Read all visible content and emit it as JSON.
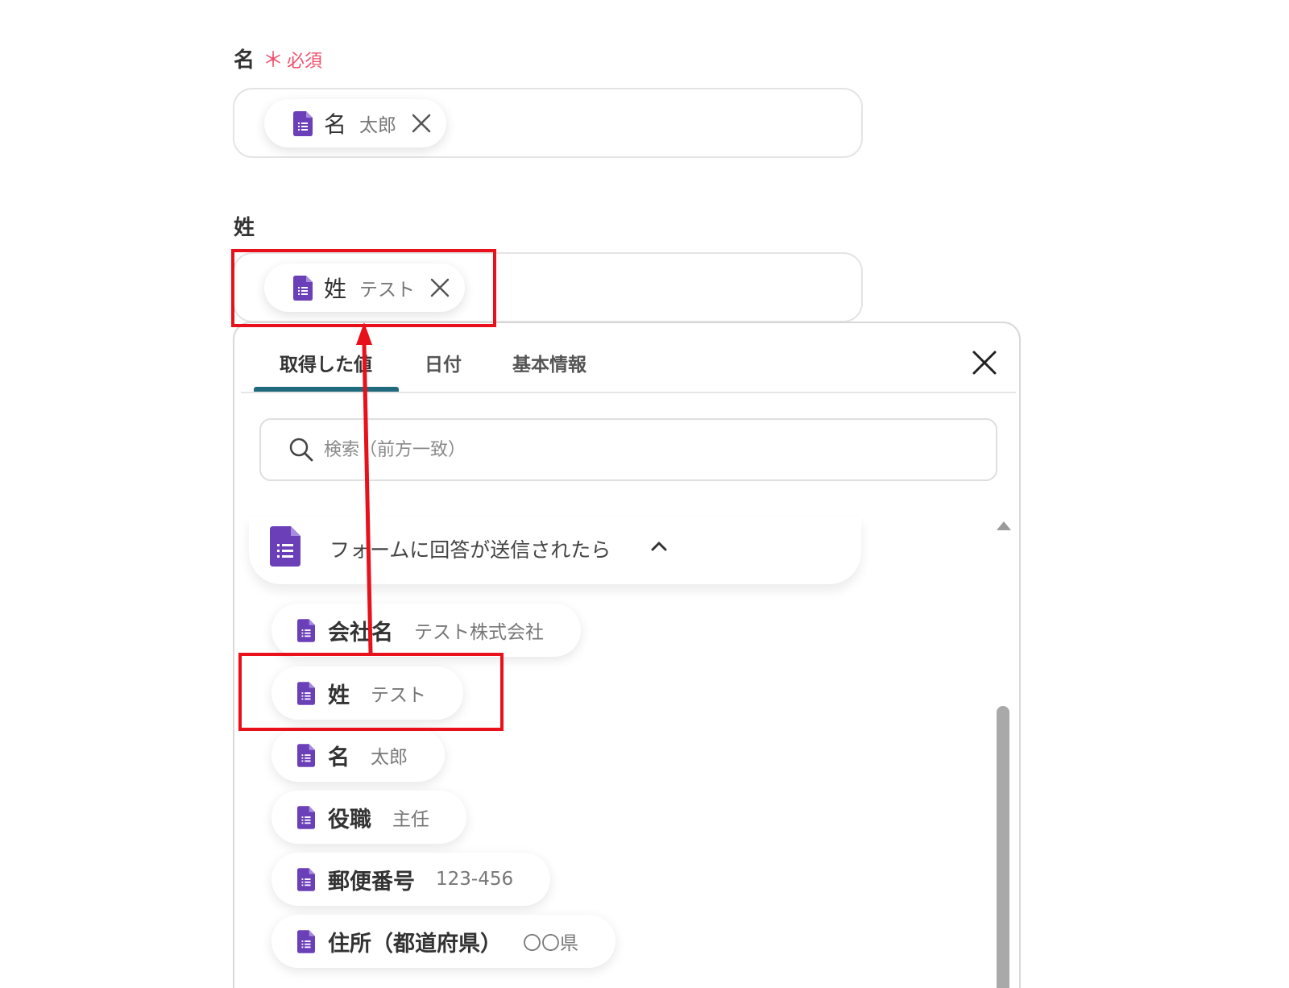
{
  "fields": {
    "first_name": {
      "label": "名",
      "required_mark": "＊",
      "required_text": "必須",
      "chip": {
        "name": "名",
        "value": "太郎"
      }
    },
    "last_name": {
      "label": "姓",
      "chip": {
        "name": "姓",
        "value": "テスト"
      }
    }
  },
  "picker": {
    "tabs": [
      {
        "label": "取得した値",
        "active": true
      },
      {
        "label": "日付",
        "active": false
      },
      {
        "label": "基本情報",
        "active": false
      }
    ],
    "search_placeholder": "検索（前方一致）",
    "section": {
      "title": "フォームに回答が送信されたら",
      "expanded": true
    },
    "items": [
      {
        "name": "会社名",
        "value": "テスト株式会社"
      },
      {
        "name": "姓",
        "value": "テスト"
      },
      {
        "name": "名",
        "value": "太郎"
      },
      {
        "name": "役職",
        "value": "主任"
      },
      {
        "name": "郵便番号",
        "value": "123-456"
      },
      {
        "name": "住所（都道府県）",
        "value": "〇〇県"
      }
    ]
  },
  "colors": {
    "accent_tab": "#1f6a7c",
    "highlight": "#e8101a",
    "required": "#f0506e",
    "forms_icon": "#6b3fb8"
  },
  "icons": {
    "form_icon": "google-forms-icon",
    "close_icon": "close-icon",
    "search_icon": "search-icon",
    "chevron": "chevron-up-icon"
  }
}
